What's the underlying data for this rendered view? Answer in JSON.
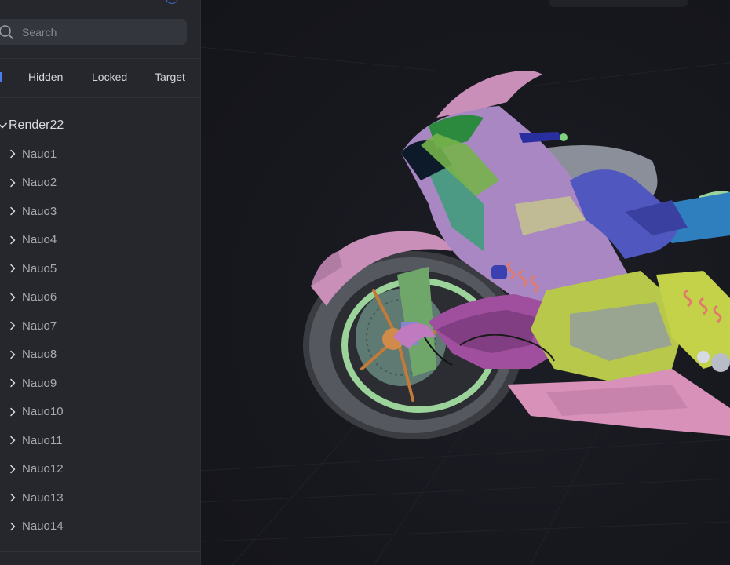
{
  "search": {
    "placeholder": "Search",
    "icon": "search-icon"
  },
  "filters": [
    {
      "label": "Hidden"
    },
    {
      "label": "Locked"
    },
    {
      "label": "Target"
    }
  ],
  "tree": {
    "root": {
      "label": "Render22",
      "expanded": true
    },
    "items": [
      {
        "label": "Nauo1"
      },
      {
        "label": "Nauo2"
      },
      {
        "label": "Nauo3"
      },
      {
        "label": "Nauo4"
      },
      {
        "label": "Nauo5"
      },
      {
        "label": "Nauo6"
      },
      {
        "label": "Nauo7"
      },
      {
        "label": "Nauo8"
      },
      {
        "label": "Nauo9"
      },
      {
        "label": "Nauo10"
      },
      {
        "label": "Nauo11"
      },
      {
        "label": "Nauo12"
      },
      {
        "label": "Nauo13"
      },
      {
        "label": "Nauo14"
      }
    ]
  },
  "colors": {
    "sidebar_bg": "#25272c",
    "viewport_bg": "#16171d",
    "accent": "#4a7cf0"
  }
}
